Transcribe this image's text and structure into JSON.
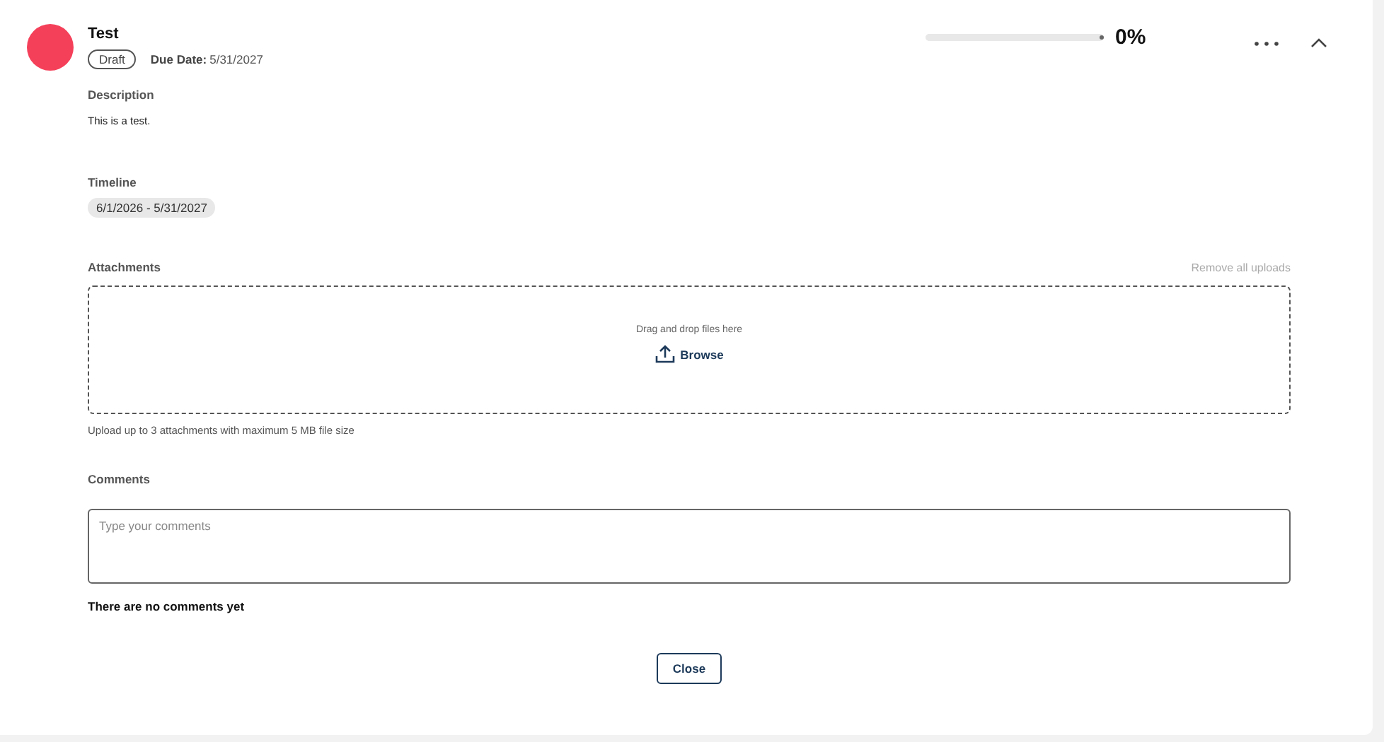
{
  "header": {
    "title": "Test",
    "status": "Draft",
    "due_label": "Due Date:",
    "due_date": "5/31/2027",
    "progress": {
      "level": 0,
      "reading": "0%"
    },
    "expanded": true
  },
  "description": {
    "label": "Description",
    "text": "This is a test."
  },
  "timeline": {
    "label": "Timeline",
    "range": "6/1/2026 - 5/31/2027"
  },
  "attachments": {
    "label": "Attachments",
    "remove_all": {
      "label": "Remove all uploads",
      "disabled": true
    },
    "drop_hint": "Drag and drop files here",
    "browse": "Browse",
    "note": "Upload up to 3 attachments with maximum 5 MB file size"
  },
  "comments": {
    "label": "Comments",
    "placeholder": "Type your comments",
    "empty": "There are no comments yet"
  },
  "buttons": [
    "Close"
  ]
}
